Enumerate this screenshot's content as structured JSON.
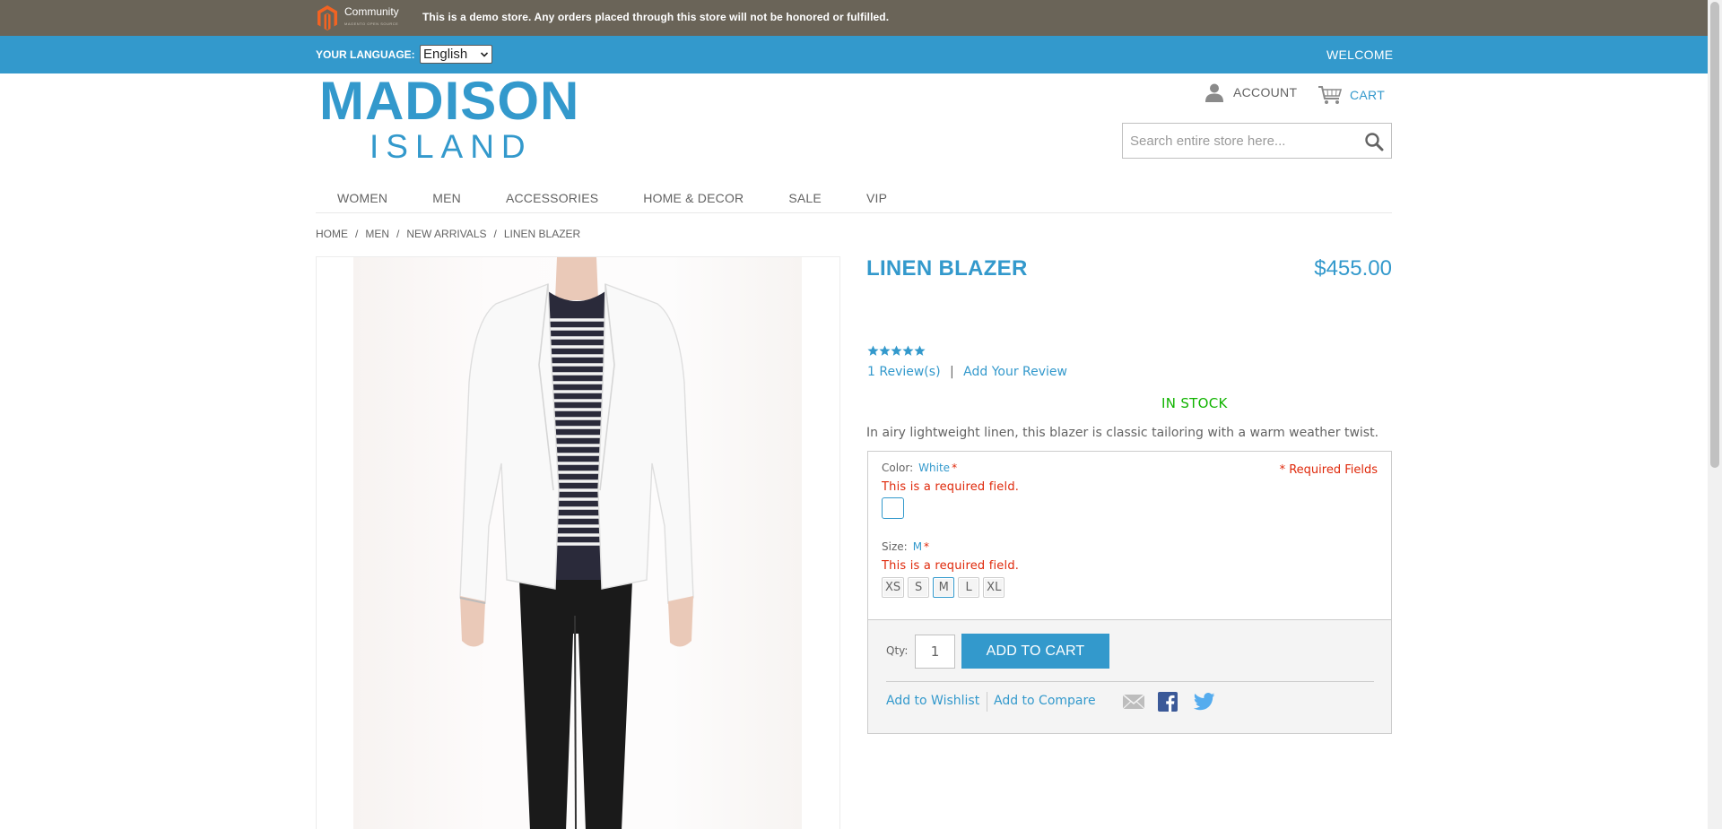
{
  "demo_notice": {
    "logo_text": "Community",
    "logo_subtext": "MAGENTO OPEN SOURCE",
    "message": "This is a demo store. Any orders placed through this store will not be honored or fulfilled."
  },
  "header": {
    "language_label": "YOUR LANGUAGE:",
    "language_value": "English",
    "welcome": "WELCOME",
    "brand_main": "MADISON",
    "brand_sub": "ISLAND",
    "account_label": "ACCOUNT",
    "cart_label": "CART",
    "search_placeholder": "Search entire store here..."
  },
  "nav": {
    "items": [
      "WOMEN",
      "MEN",
      "ACCESSORIES",
      "HOME & DECOR",
      "SALE",
      "VIP"
    ]
  },
  "breadcrumb": {
    "items": [
      "HOME",
      "MEN",
      "NEW ARRIVALS"
    ],
    "separator": "/",
    "current": "LINEN BLAZER"
  },
  "product": {
    "name": "LINEN BLAZER",
    "price": "$455.00",
    "rating_stars": 5,
    "reviews_link": "1 Review(s)",
    "review_separator": "|",
    "add_review_link": "Add Your Review",
    "stock": "IN STOCK",
    "description": "In airy lightweight linen, this blazer is classic tailoring with a warm weather twist."
  },
  "options": {
    "required_note": "* Required Fields",
    "color": {
      "label": "Color:",
      "value": "White",
      "required_mark": "*",
      "error": "This is a required field.",
      "swatch": "White"
    },
    "size": {
      "label": "Size:",
      "value": "M",
      "required_mark": "*",
      "error": "This is a required field.",
      "choices": [
        "XS",
        "S",
        "M",
        "L",
        "XL"
      ],
      "selected": "M"
    }
  },
  "purchase": {
    "qty_label": "Qty:",
    "qty_value": "1",
    "add_to_cart": "ADD TO CART",
    "wishlist_link": "Add to Wishlist",
    "compare_link": "Add to Compare",
    "share_icons": [
      "email-icon",
      "facebook-icon",
      "twitter-icon"
    ]
  },
  "colors": {
    "accent": "#3399cc",
    "demo_bar": "#6a6458",
    "in_stock": "#11b400",
    "error": "#df280a",
    "text": "#636363"
  }
}
